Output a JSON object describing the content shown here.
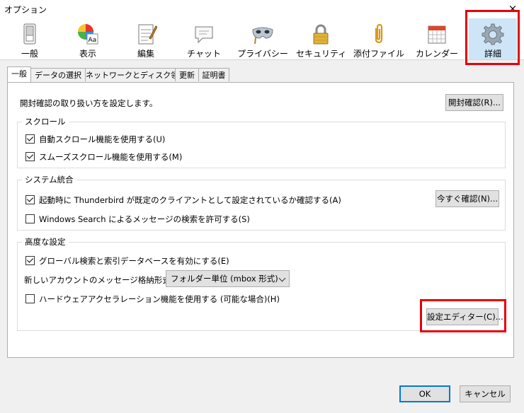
{
  "window": {
    "title": "オプション",
    "close_glyph": "×"
  },
  "toolbar": {
    "items": [
      {
        "label": "一般",
        "icon": "switch-icon"
      },
      {
        "label": "表示",
        "icon": "palette-icon"
      },
      {
        "label": "編集",
        "icon": "notepad-icon"
      },
      {
        "label": "チャット",
        "icon": "chat-icon"
      },
      {
        "label": "プライバシー",
        "icon": "mask-icon"
      },
      {
        "label": "セキュリティ",
        "icon": "lock-icon"
      },
      {
        "label": "添付ファイル",
        "icon": "paperclip-icon"
      },
      {
        "label": "カレンダー",
        "icon": "calendar-icon"
      },
      {
        "label": "詳細",
        "icon": "gear-icon",
        "selected": true
      }
    ]
  },
  "tabs": [
    "一般",
    "データの選択",
    "ネットワークとディスク領域",
    "更新",
    "証明書"
  ],
  "receipt": {
    "text": "開封確認の取り扱い方を設定します。",
    "button": "開封確認(R)..."
  },
  "scroll": {
    "title": "スクロール",
    "auto_scroll": "自動スクロール機能を使用する(U)",
    "smooth_scroll": "スムーズスクロール機能を使用する(M)"
  },
  "system": {
    "title": "システム統合",
    "default_client": "起動時に Thunderbird が既定のクライアントとして設定されているか確認する(A)",
    "check_now": "今すぐ確認(N)...",
    "windows_search": "Windows Search によるメッセージの検索を許可する(S)"
  },
  "advanced": {
    "title": "高度な設定",
    "global_search": "グローバル検索と索引データベースを有効にする(E)",
    "storage_label": "新しいアカウントのメッセージ格納形式(T):",
    "storage_value": "フォルダー単位 (mbox 形式)",
    "hw_accel": "ハードウェアアクセラレーション機能を使用する (可能な場合)(H)",
    "config_editor": "設定エディター(C)..."
  },
  "footer": {
    "ok": "OK",
    "cancel": "キャンセル"
  },
  "colors": {
    "highlight_red": "#e8000b",
    "selected_tab": "#cde5f7",
    "primary_border": "#0078d7"
  }
}
